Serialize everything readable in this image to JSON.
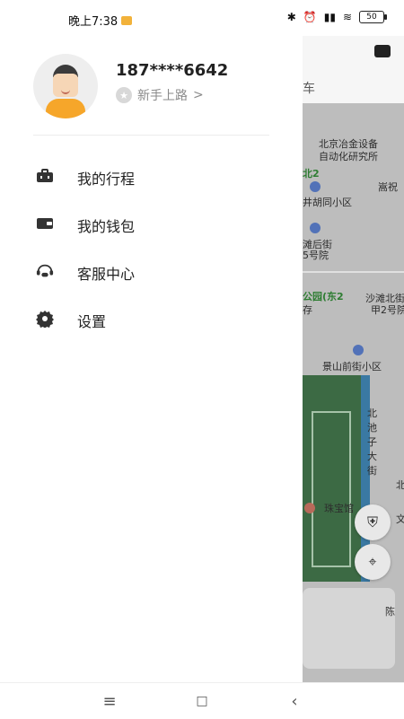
{
  "status": {
    "time": "晚上7:38",
    "battery": "50"
  },
  "user": {
    "phone": "187****6642",
    "level": "新手上路",
    "level_chevron": ">"
  },
  "menu": [
    {
      "label": "我的行程",
      "icon": "briefcase-icon"
    },
    {
      "label": "我的钱包",
      "icon": "wallet-icon"
    },
    {
      "label": "客服中心",
      "icon": "support-icon"
    },
    {
      "label": "设置",
      "icon": "gear-icon"
    }
  ],
  "map": {
    "top_partial": "车",
    "labels": [
      {
        "text": "北京冶金设备"
      },
      {
        "text": "自动化研究所"
      },
      {
        "text": "嵩祝"
      },
      {
        "text": "北2"
      },
      {
        "text": "井胡同小区"
      },
      {
        "text": "滩后街"
      },
      {
        "text": "5号院"
      },
      {
        "text": "公园(东2"
      },
      {
        "text": "沙滩北街"
      },
      {
        "text": "甲2号院"
      },
      {
        "text": "存"
      },
      {
        "text": "景山前街小区"
      },
      {
        "text": "北"
      },
      {
        "text": "池"
      },
      {
        "text": "子"
      },
      {
        "text": "大"
      },
      {
        "text": "街"
      },
      {
        "text": "北"
      },
      {
        "text": "珠宝馆"
      },
      {
        "text": "文"
      },
      {
        "text": "陈"
      }
    ]
  },
  "colors": {
    "accent_orange": "#f6a62a",
    "map_gray": "#bdbdbd",
    "text_dark": "#222222"
  }
}
